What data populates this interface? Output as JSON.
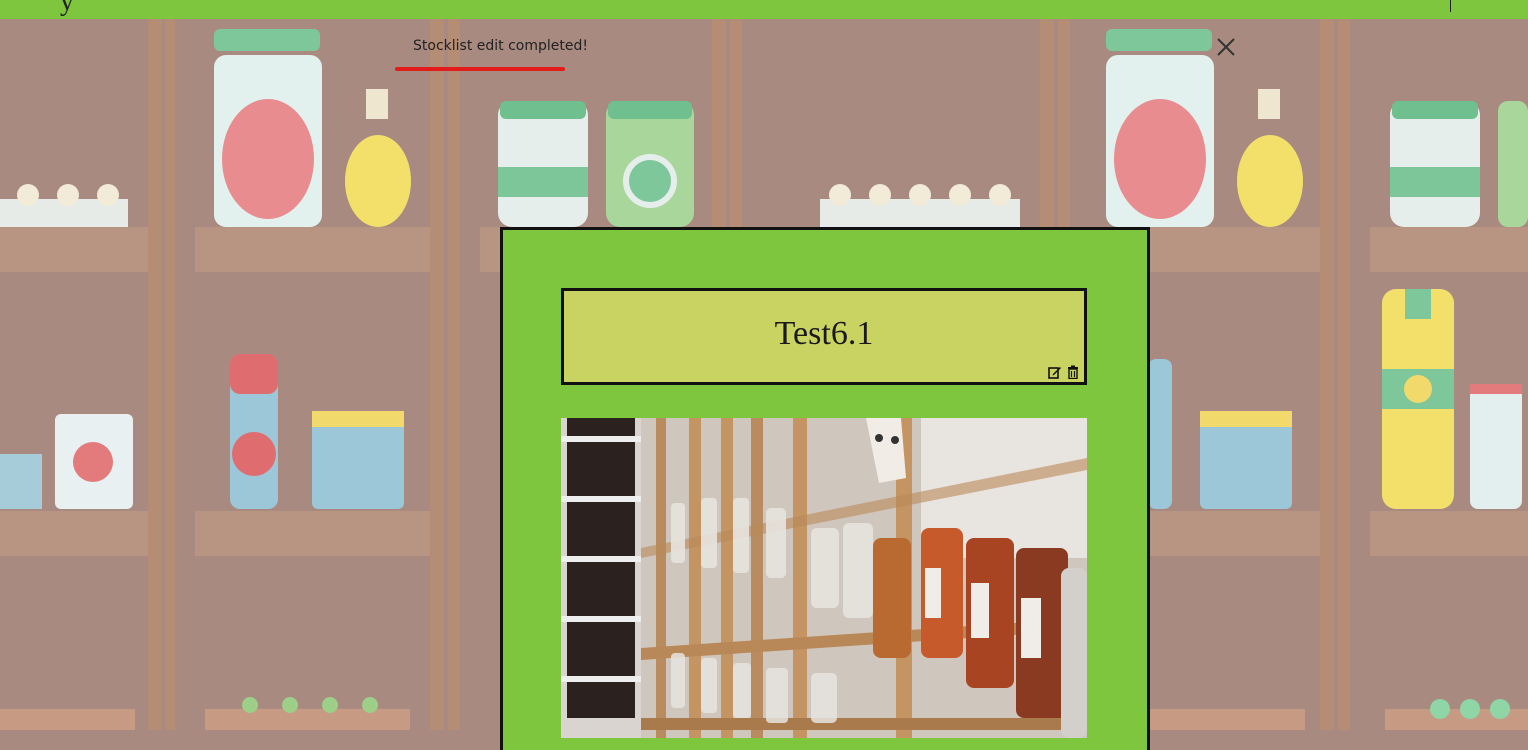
{
  "header": {
    "brand_fragment": "y"
  },
  "toast": {
    "message": "Stocklist edit completed!",
    "progress": 0.2,
    "progress_color": "#e21b1b"
  },
  "stocklist": {
    "title": "Test6.1",
    "edit_icon": "edit-icon",
    "delete_icon": "trash-icon",
    "image_alt": "Shelves of glass jars"
  },
  "colors": {
    "header_green": "#7fc63f",
    "panel_green": "#7fc63f",
    "title_box": "#c9d362"
  }
}
